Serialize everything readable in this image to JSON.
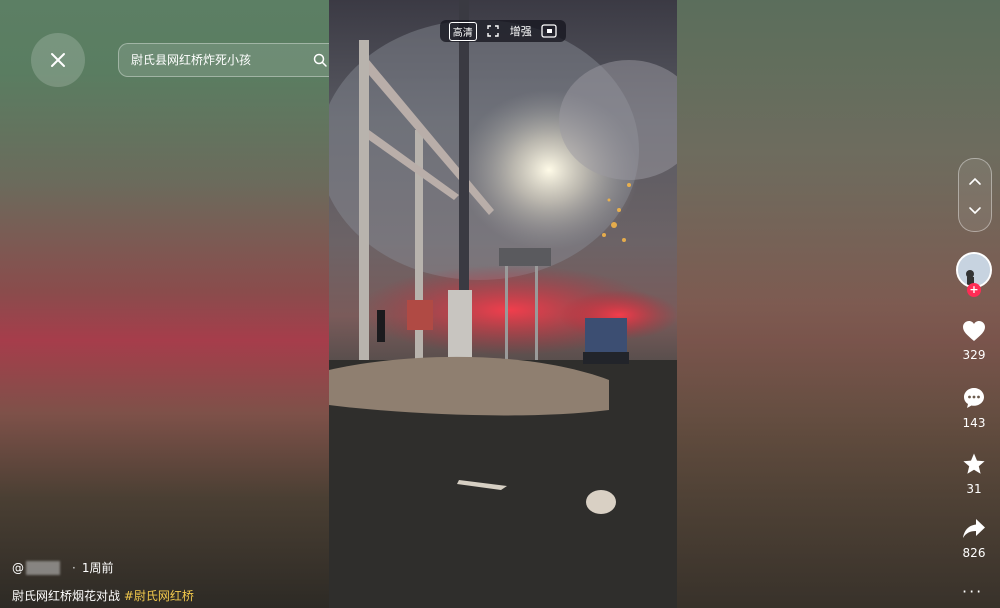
{
  "search": {
    "placeholder": "尉氏县网红桥炸死小孩",
    "button_label": "搜索"
  },
  "toolbar": {
    "items": [
      {
        "label": "高清",
        "icon": "quality-icon"
      },
      {
        "label": "",
        "icon": "fullscreen-icon"
      },
      {
        "label": "增强",
        "icon": "enhance-icon"
      },
      {
        "label": "",
        "icon": "picture-in-picture-icon"
      }
    ]
  },
  "post": {
    "author_prefix": "@",
    "time": "1周前",
    "title": "尉氏网红桥烟花对战",
    "hashtag": "#尉氏网红桥"
  },
  "actions": {
    "likes": "329",
    "comments": "143",
    "favorites": "31",
    "shares": "826",
    "more": "···"
  },
  "colors": {
    "like_active": "#ffffff",
    "follow_badge": "#fe2c55",
    "hashtag": "#f2c94c"
  }
}
